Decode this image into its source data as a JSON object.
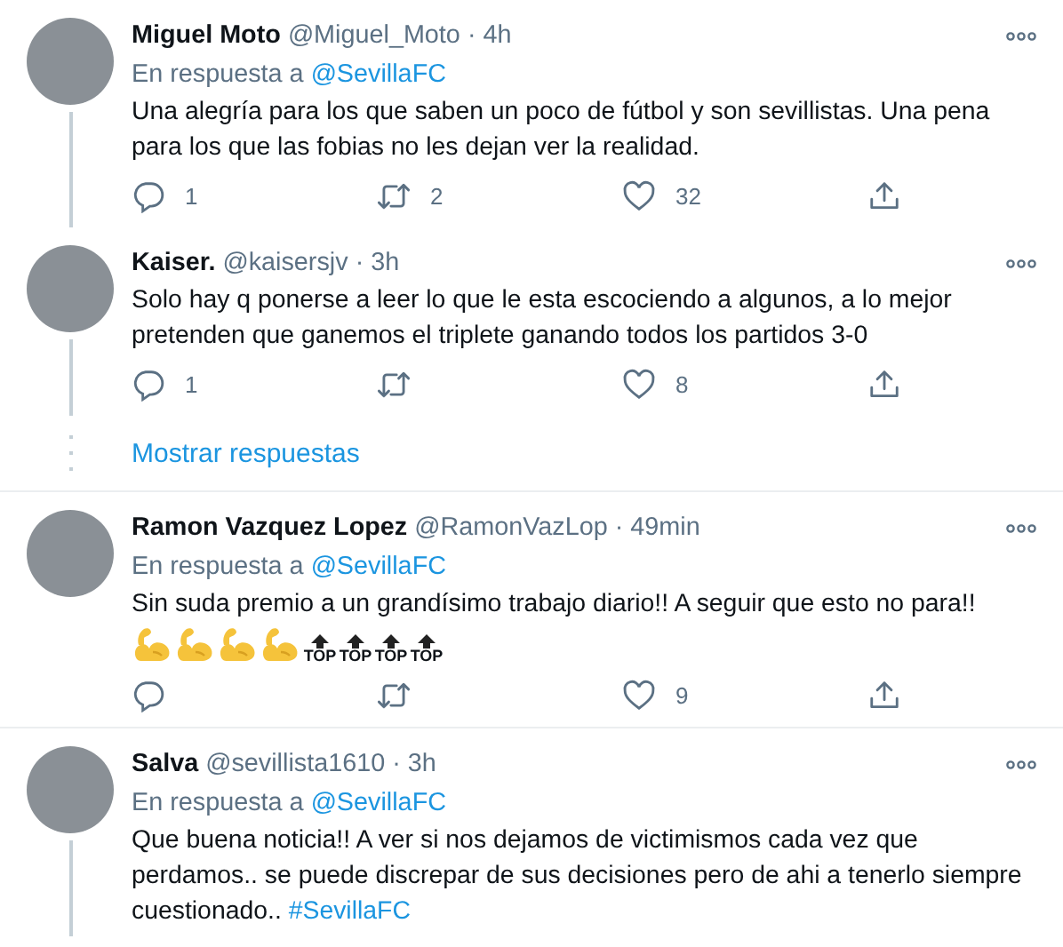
{
  "items": [
    {
      "kind": "tweet",
      "name": "Miguel Moto",
      "handle": "@Miguel_Moto",
      "time": "· 4h",
      "thread": true,
      "replying_to": {
        "label": "En respuesta a",
        "handle": "@SevillaFC"
      },
      "text": [
        {
          "kind": "text",
          "text": "Una alegría para los que saben un poco de fútbol y son sevillistas. Una pena para los que las fobias no les dejan ver la realidad."
        }
      ],
      "actions": [
        {
          "kind": "reply",
          "count": "1"
        },
        {
          "kind": "retweet",
          "count": "2"
        },
        {
          "kind": "like",
          "count": "32"
        },
        {
          "kind": "share"
        }
      ]
    },
    {
      "kind": "tweet",
      "name": "Kaiser.",
      "handle": "@kaisersjv",
      "time": "· 3h",
      "thread": true,
      "text": [
        {
          "kind": "text",
          "text": "Solo hay q ponerse a leer lo que le esta escociendo a algunos, a lo mejor pretenden que ganemos el triplete ganando todos los partidos 3-0"
        }
      ],
      "actions": [
        {
          "kind": "reply",
          "count": "1"
        },
        {
          "kind": "retweet"
        },
        {
          "kind": "like",
          "count": "8"
        },
        {
          "kind": "share"
        }
      ]
    },
    {
      "kind": "show-more",
      "label": "Mostrar respuestas"
    },
    {
      "kind": "tweet",
      "name": "Ramon Vazquez Lopez",
      "handle": "@RamonVazLop",
      "time": "· 49min",
      "thread": false,
      "replying_to": {
        "label": "En respuesta a",
        "handle": "@SevillaFC"
      },
      "text": [
        {
          "kind": "text",
          "text": "Sin suda premio a un grandísimo trabajo diario!! A seguir que esto no para!!"
        }
      ],
      "emojis": [
        {
          "kind": "biceps"
        },
        {
          "kind": "biceps"
        },
        {
          "kind": "biceps"
        },
        {
          "kind": "biceps"
        },
        {
          "kind": "top",
          "label": "TOP"
        },
        {
          "kind": "top",
          "label": "TOP"
        },
        {
          "kind": "top",
          "label": "TOP"
        },
        {
          "kind": "top",
          "label": "TOP"
        }
      ],
      "actions": [
        {
          "kind": "reply"
        },
        {
          "kind": "retweet"
        },
        {
          "kind": "like",
          "count": "9"
        },
        {
          "kind": "share"
        }
      ]
    },
    {
      "kind": "tweet",
      "name": "Salva",
      "handle": "@sevillista1610",
      "time": "· 3h",
      "thread": true,
      "replying_to": {
        "label": "En respuesta a",
        "handle": "@SevillaFC"
      },
      "text": [
        {
          "kind": "text",
          "text": "Que buena noticia!! A ver si nos dejamos de victimismos cada vez que perdamos.. se puede discrepar de sus decisiones pero de ahi a tenerlo siempre cuestionado.. "
        },
        {
          "kind": "link",
          "text": "#SevillaFC"
        }
      ]
    }
  ]
}
